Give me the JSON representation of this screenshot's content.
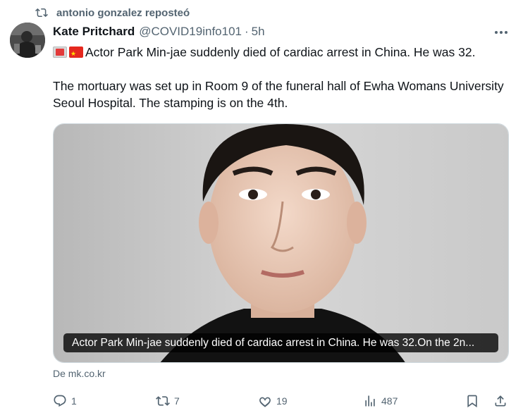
{
  "repost": {
    "icon": "repost-icon",
    "text": "antonio gonzalez reposteó"
  },
  "author": {
    "name": "Kate Pritchard",
    "handle": "@COVID19info101",
    "separator": "·",
    "time": "5h"
  },
  "tweet": {
    "flags": [
      "macau-flag-emoji",
      "china-flag-emoji"
    ],
    "line1": "Actor Park Min-jae suddenly died of cardiac arrest in China. He was 32.",
    "para2": "The mortuary was set up in Room 9 of the funeral hall of Ewha Womans University Seoul Hospital. The stamping is on the 4th."
  },
  "media": {
    "caption": "Actor Park Min-jae suddenly died of cardiac arrest in China. He was 32.On the 2n..."
  },
  "source": "De mk.co.kr",
  "actions": {
    "replies": "1",
    "reposts": "7",
    "likes": "19",
    "views": "487"
  },
  "icons": [
    "repost-icon",
    "avatar",
    "more-icon",
    "reply-icon",
    "retweet-icon",
    "heart-icon",
    "views-icon",
    "bookmark-icon",
    "share-icon"
  ]
}
